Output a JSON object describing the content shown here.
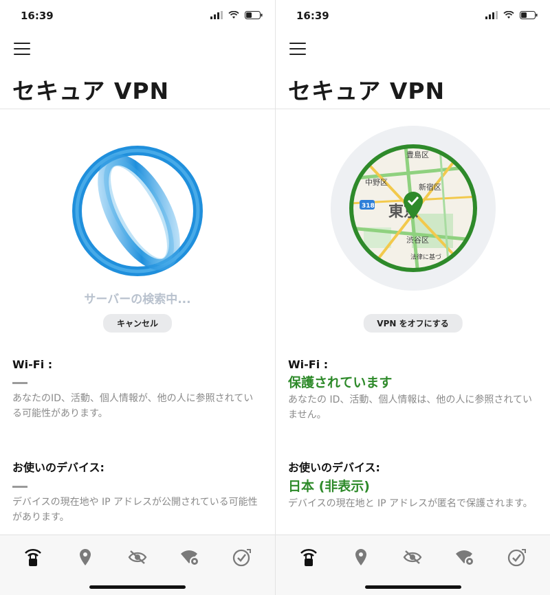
{
  "left": {
    "time": "16:39",
    "title": "セキュア VPN",
    "search_status": "サーバーの検索中...",
    "button": "キャンセル",
    "wifi": {
      "label": "Wi-Fi :",
      "desc": "あなたのID、活動、個人情報が、他の人に参照されている可能性があります。"
    },
    "device": {
      "label": "お使いのデバイス:",
      "desc": "デバイスの現在地や IP アドレスが公開されている可能性があります。"
    }
  },
  "right": {
    "time": "16:39",
    "title": "セキュア VPN",
    "button": "VPN をオフにする",
    "map_labels": [
      "豊島区",
      "中野区",
      "新宿区",
      "東京",
      "渋谷区",
      "318",
      "法律に基づ"
    ],
    "wifi": {
      "label": "Wi-Fi :",
      "value": "保護されています",
      "desc": "あなたの ID、活動、個人情報は、他の人に参照されていません。"
    },
    "device": {
      "label": "お使いのデバイス:",
      "value": "日本 (非表示)",
      "desc": "デバイスの現在地と IP アドレスが匿名で保護されます。"
    }
  },
  "tabs": [
    "vpn-lock-icon",
    "location-pin-icon",
    "eye-slash-icon",
    "wifi-gear-icon",
    "shield-check-icon"
  ],
  "colors": {
    "accent_blue": "#1f8fdc",
    "protected_green": "#2e8a2a",
    "gray_text": "#8a8a8a"
  }
}
